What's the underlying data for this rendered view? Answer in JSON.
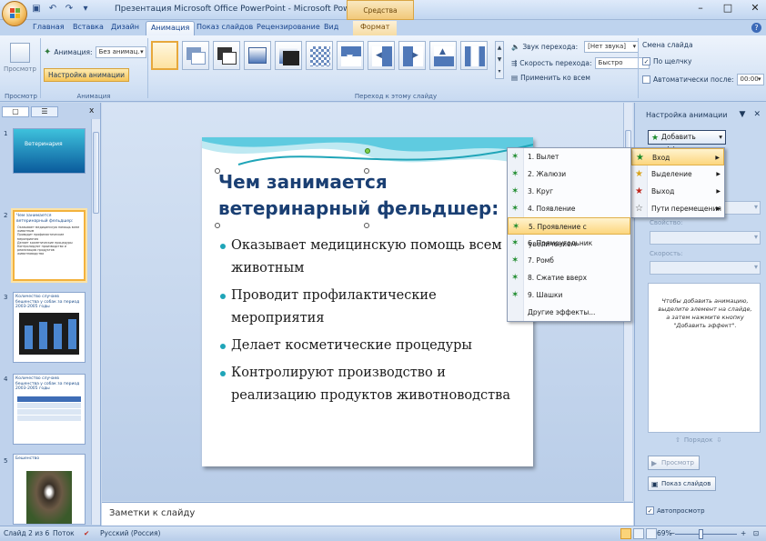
{
  "window": {
    "title": "Презентация Microsoft Office PowerPoint - Microsoft PowerPoint",
    "context_tab_group": "Средства рисования",
    "controls": [
      "–",
      "□",
      "✕"
    ]
  },
  "qat": {
    "icons": [
      "save-icon",
      "undo-icon",
      "redo-icon",
      "customize-icon"
    ]
  },
  "tabs": [
    {
      "label": "Главная"
    },
    {
      "label": "Вставка"
    },
    {
      "label": "Дизайн"
    },
    {
      "label": "Анимация",
      "active": true
    },
    {
      "label": "Показ слайдов"
    },
    {
      "label": "Рецензирование"
    },
    {
      "label": "Вид"
    },
    {
      "label": "Формат",
      "contextual": true
    }
  ],
  "ribbon": {
    "preview_group": {
      "button": "Просмотр",
      "label": "Просмотр"
    },
    "animation_group": {
      "animation_label": "Анимация:",
      "animation_value": "Без анимац.",
      "setup_button": "Настройка анимации",
      "label": "Анимация"
    },
    "transition_group": {
      "label": "Переход к этому слайду",
      "sound_label": "Звук перехода:",
      "sound_value": "[Нет звука]",
      "speed_label": "Скорость перехода:",
      "speed_value": "Быстро",
      "apply_all": "Применить ко всем",
      "change_slide": "Смена слайда",
      "on_click": "По щелчку",
      "auto_after": "Автоматически после:",
      "auto_time": "00:00"
    }
  },
  "slides_pane": {
    "tab_icons": [
      "slides-tab-icon",
      "outline-tab-icon"
    ],
    "close": "x",
    "thumbnails": [
      {
        "num": "1",
        "title": "Ветеринария"
      },
      {
        "num": "2",
        "title": "Чем занимается ветеринарный фельдшер:",
        "selected": true,
        "lines": [
          "Оказывает медицинскую помощь всем животным",
          "Проводит профилактические мероприятия",
          "Делает косметические процедуры",
          "Контролируют производство и реализацию продуктов животноводства"
        ]
      },
      {
        "num": "3",
        "title": "Количество случаев бешенства у собак за период 2003-2005 годы"
      },
      {
        "num": "4",
        "title": "Количество случаев бешенства у собак за период 2003-2005 годы"
      },
      {
        "num": "5",
        "title": "Бешенство"
      }
    ]
  },
  "slide": {
    "title": "Чем занимается ветеринарный фельдшер:",
    "bullets": [
      "Оказывает медицинскую помощь всем животным",
      "Проводит профилактические мероприятия",
      "Делает косметические процедуры",
      "Контролируют производство и реализацию продуктов животноводства"
    ]
  },
  "notes": {
    "placeholder": "Заметки к слайду"
  },
  "task_pane": {
    "title": "Настройка анимации",
    "add_effect": "Добавить эффект",
    "fields": [
      "",
      "Свойство:",
      "Скорость:"
    ],
    "hint": "Чтобы добавить анимацию, выделите элемент на слайде, а затем нажмите кнопку \"Добавить эффект\".",
    "order": "Порядок",
    "play": "Просмотр",
    "slideshow": "Показ слайдов",
    "autopreview": "Автопросмотр"
  },
  "add_effect_menu": [
    {
      "label": "Вход",
      "icon": "entrance-star-icon",
      "color": "#1a8a2a",
      "highlighted": true
    },
    {
      "label": "Выделение",
      "icon": "emphasis-star-icon",
      "color": "#d9a31a"
    },
    {
      "label": "Выход",
      "icon": "exit-star-icon",
      "color": "#c0281e"
    },
    {
      "label": "Пути перемещения",
      "icon": "motion-path-icon",
      "color": "#555555"
    }
  ],
  "entrance_menu": [
    {
      "label": "1. Вылет"
    },
    {
      "label": "2. Жалюзи"
    },
    {
      "label": "3. Круг"
    },
    {
      "label": "4. Появление"
    },
    {
      "label": "5. Проявление с увеличением",
      "highlighted": true
    },
    {
      "label": "6. Прямоугольник"
    },
    {
      "label": "7. Ромб"
    },
    {
      "label": "8. Сжатие вверх"
    },
    {
      "label": "9. Шашки"
    },
    {
      "label": "Другие эффекты..."
    }
  ],
  "status": {
    "slide_info": "Слайд 2 из 6",
    "theme": "Поток",
    "language": "Русский (Россия)",
    "zoom": "69%"
  },
  "colors": {
    "accent": "#f3b23d",
    "title_blue": "#1a3f73",
    "bullet": "#1fa5b8"
  }
}
